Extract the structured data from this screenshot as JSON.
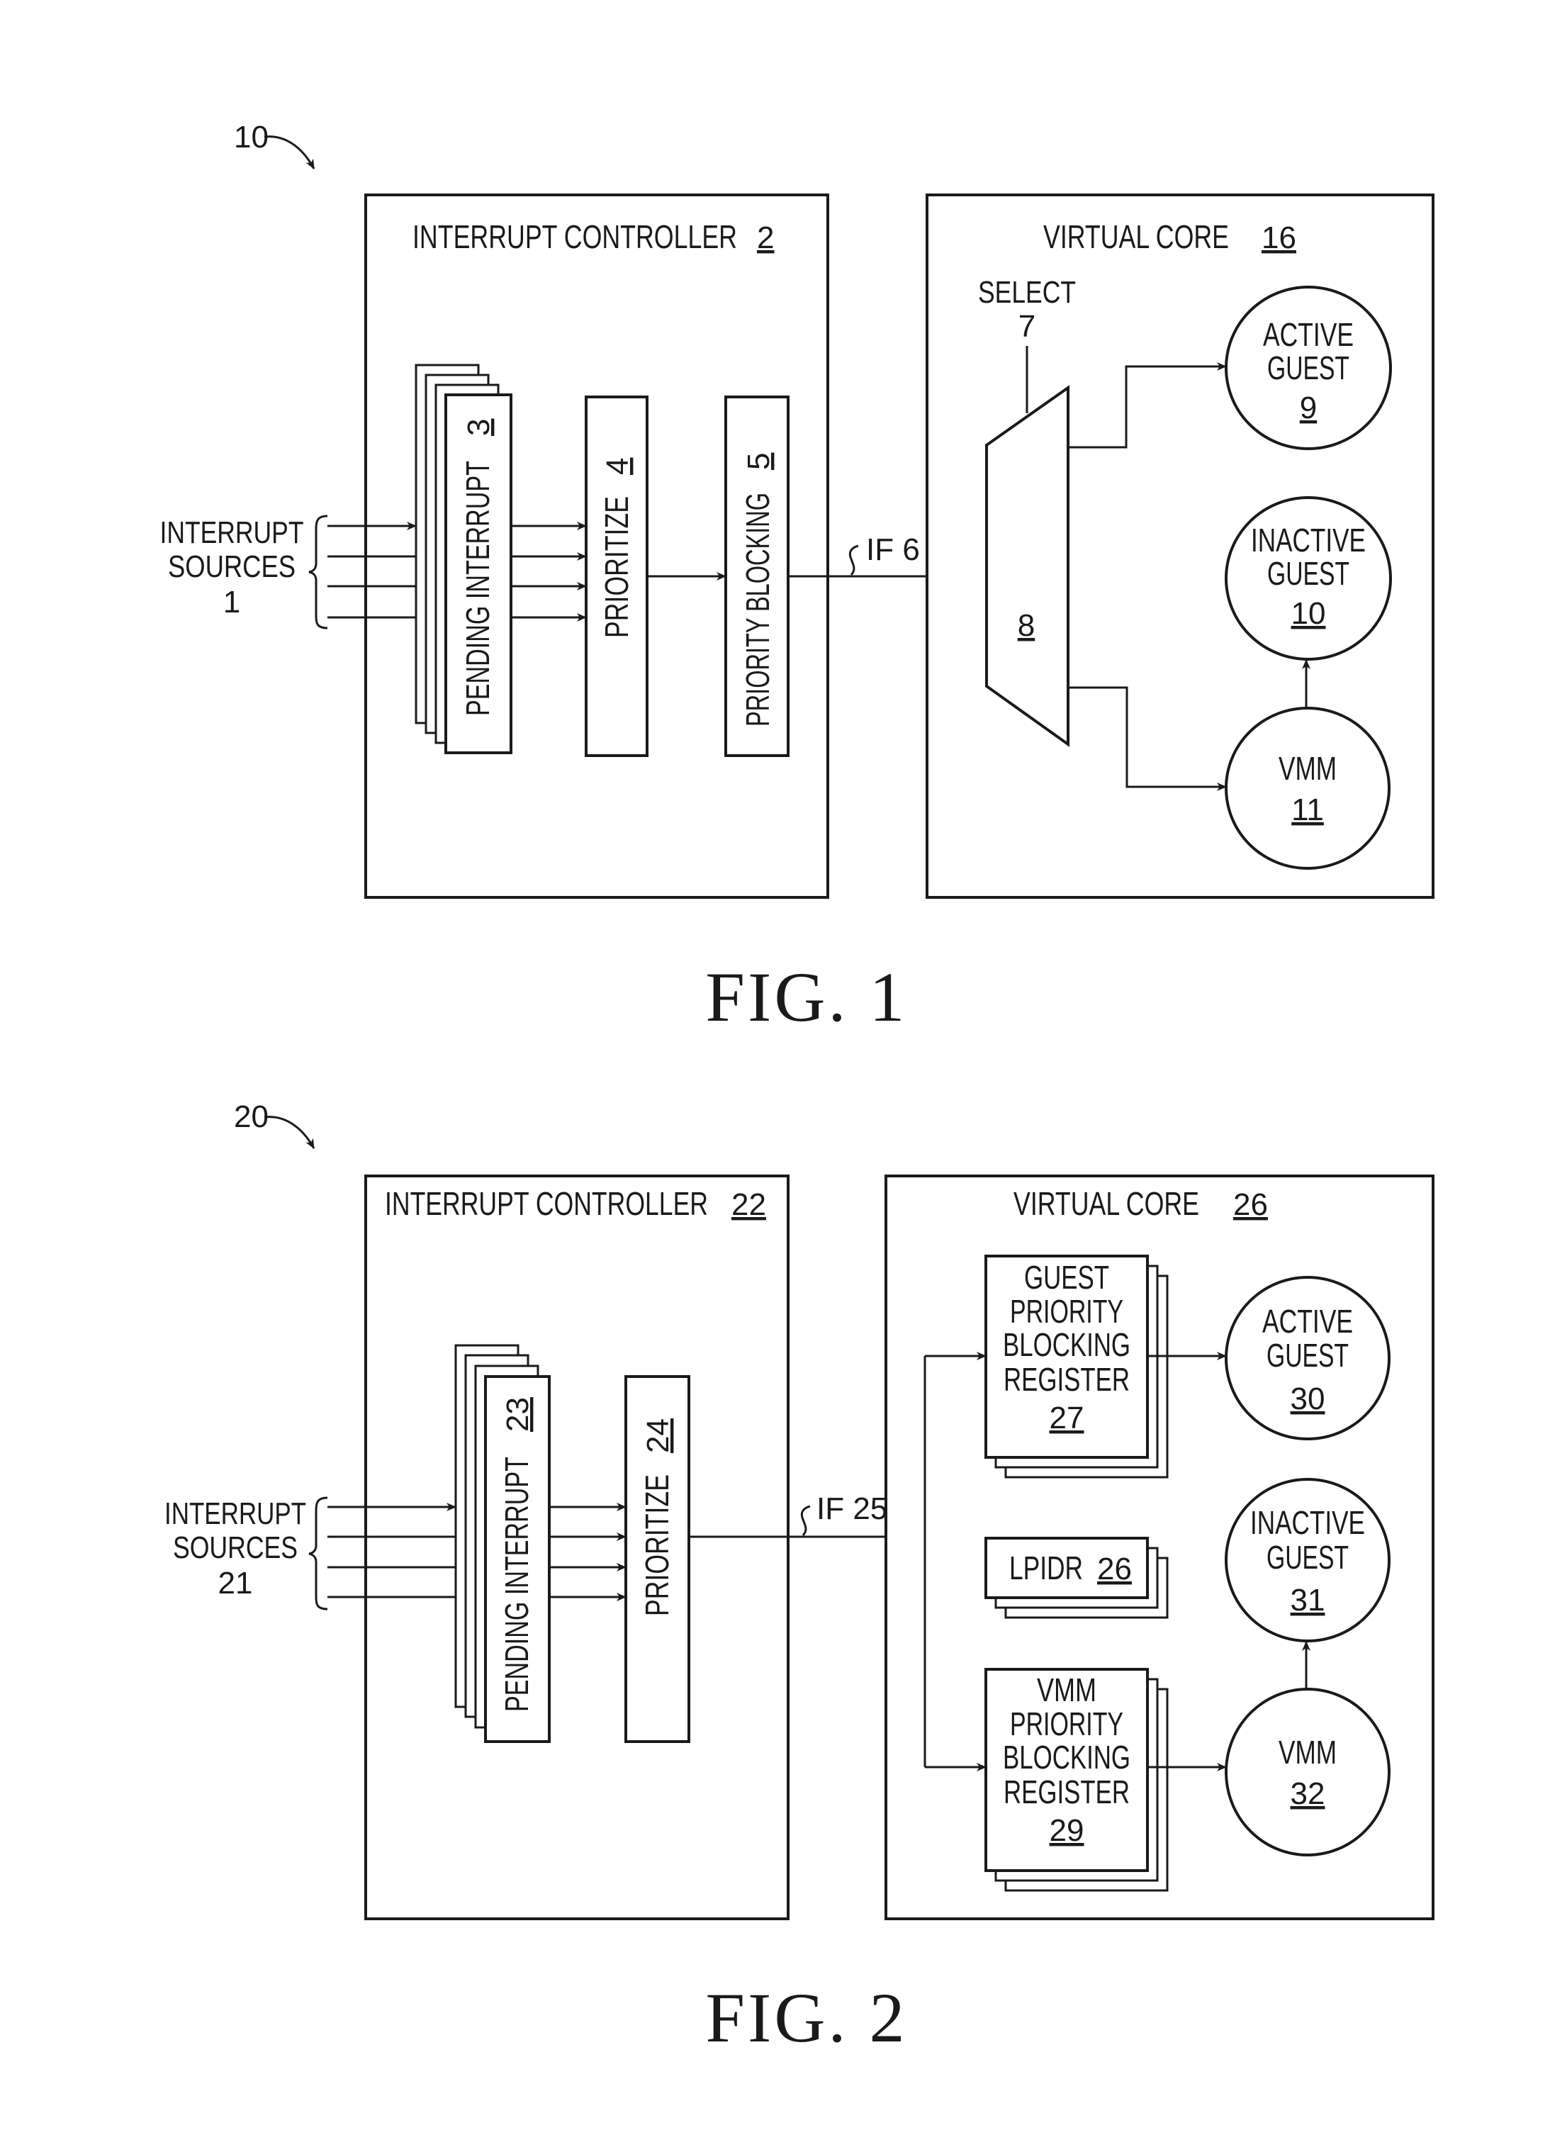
{
  "figures": [
    {
      "ref": "10",
      "caption": "FIG. 1",
      "sources": {
        "line1": "INTERRUPT",
        "line2": "SOURCES",
        "ref": "1"
      },
      "controller": {
        "label": "INTERRUPT CONTROLLER",
        "ref": "2"
      },
      "pending": {
        "label": "PENDING INTERRUPT",
        "ref": "3"
      },
      "prioritize": {
        "label": "PRIORITIZE",
        "ref": "4"
      },
      "blocking": {
        "label": "PRIORITY BLOCKING",
        "ref": "5"
      },
      "interface": {
        "label": "IF 6"
      },
      "core": {
        "label": "VIRTUAL CORE",
        "ref": "16"
      },
      "select": {
        "label": "SELECT",
        "ref": "7"
      },
      "mux": {
        "ref": "8"
      },
      "active": {
        "line1": "ACTIVE",
        "line2": "GUEST",
        "ref": "9"
      },
      "inactive": {
        "line1": "INACTIVE",
        "line2": "GUEST",
        "ref": "10"
      },
      "vmm": {
        "line1": "VMM",
        "ref": "11"
      }
    },
    {
      "ref": "20",
      "caption": "FIG. 2",
      "sources": {
        "line1": "INTERRUPT",
        "line2": "SOURCES",
        "ref": "21"
      },
      "controller": {
        "label": "INTERRUPT CONTROLLER",
        "ref": "22"
      },
      "pending": {
        "label": "PENDING INTERRUPT",
        "ref": "23"
      },
      "prioritize": {
        "label": "PRIORITIZE",
        "ref": "24"
      },
      "interface": {
        "label": "IF 25"
      },
      "core": {
        "label": "VIRTUAL CORE",
        "ref": "26"
      },
      "guest_reg": {
        "lines": [
          "GUEST",
          "PRIORITY",
          "BLOCKING",
          "REGISTER"
        ],
        "ref": "27"
      },
      "lpidr": {
        "label": "LPIDR",
        "ref": "26"
      },
      "vmm_reg": {
        "lines": [
          "VMM",
          "PRIORITY",
          "BLOCKING",
          "REGISTER"
        ],
        "ref": "29"
      },
      "active": {
        "line1": "ACTIVE",
        "line2": "GUEST",
        "ref": "30"
      },
      "inactive": {
        "line1": "INACTIVE",
        "line2": "GUEST",
        "ref": "31"
      },
      "vmm": {
        "line1": "VMM",
        "ref": "32"
      }
    }
  ]
}
